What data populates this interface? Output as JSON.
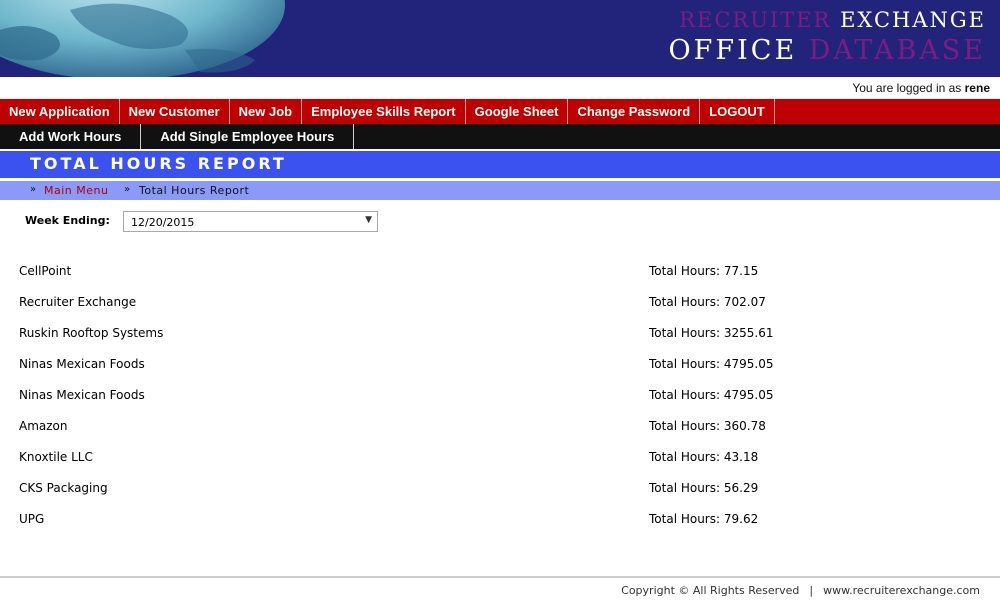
{
  "brand": {
    "line1_a": "RECRUITER",
    "line1_b": "EXCHANGE",
    "line2_a": "OFFICE",
    "line2_b": "DATABASE"
  },
  "login": {
    "prefix": "You are logged in as",
    "user": "rene"
  },
  "nav_main": [
    "New Application",
    "New Customer",
    "New Job",
    "Employee Skills Report",
    "Google Sheet",
    "Change Password",
    "LOGOUT"
  ],
  "nav_sub": [
    "Add Work Hours",
    "Add Single Employee Hours"
  ],
  "page_title": "TOTAL HOURS REPORT",
  "breadcrumb": {
    "main": "Main Menu",
    "current": "Total Hours Report"
  },
  "week_ending": {
    "label": "Week Ending:",
    "value": "12/20/2015"
  },
  "report": [
    {
      "name": "CellPoint",
      "total": "Total Hours: 77.15"
    },
    {
      "name": "Recruiter Exchange",
      "total": "Total Hours: 702.07"
    },
    {
      "name": "Ruskin Rooftop Systems",
      "total": "Total Hours: 3255.61"
    },
    {
      "name": "Ninas Mexican Foods",
      "total": "Total Hours: 4795.05"
    },
    {
      "name": "Ninas Mexican Foods",
      "total": "Total Hours: 4795.05"
    },
    {
      "name": "Amazon",
      "total": "Total Hours: 360.78"
    },
    {
      "name": "Knoxtile LLC",
      "total": "Total Hours: 43.18"
    },
    {
      "name": "CKS Packaging",
      "total": "Total Hours: 56.29"
    },
    {
      "name": "UPG",
      "total": "Total Hours: 79.62"
    }
  ],
  "footer": {
    "copyright": "Copyright © All Rights Reserved",
    "separator": "|",
    "site": "www.recruiterexchange.com"
  },
  "colors": {
    "header_bg": "#21247a",
    "brand_purple": "#7e1b86",
    "nav_red": "#bf0000",
    "nav_black": "#111111",
    "title_blue": "#3c52f0",
    "breadcrumb_blue": "#8b9af7"
  },
  "icons": {
    "globe": "globe-image",
    "breadcrumb_separator": "double-chevron-right-icon",
    "select_arrow": "triangle-down-icon"
  }
}
